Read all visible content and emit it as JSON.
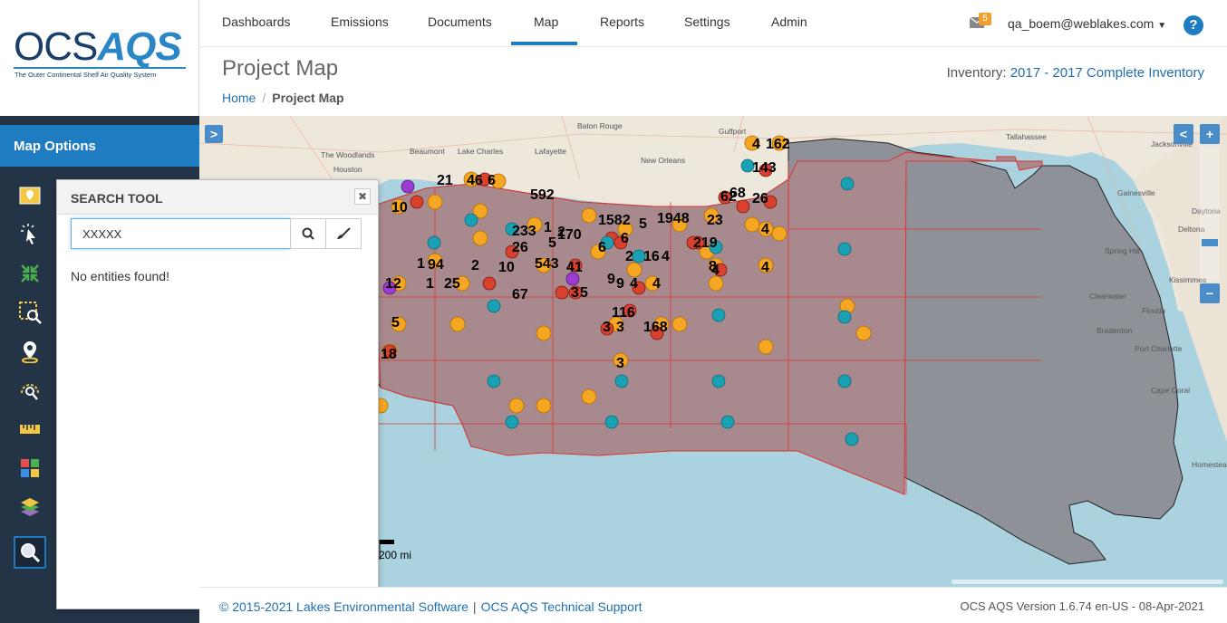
{
  "brand": {
    "logo_ocs": "OCS",
    "logo_aqs": "AQS",
    "tagline": "The Outer Continental Shelf Air Quality System"
  },
  "nav": {
    "items": [
      {
        "label": "Dashboards"
      },
      {
        "label": "Emissions"
      },
      {
        "label": "Documents"
      },
      {
        "label": "Map"
      },
      {
        "label": "Reports"
      },
      {
        "label": "Settings"
      },
      {
        "label": "Admin"
      }
    ],
    "active": "Map",
    "mail_count": "5",
    "user": "qa_boem@weblakes.com",
    "help": "?"
  },
  "page": {
    "title": "Project Map",
    "inventory_label": "Inventory:",
    "inventory_value": "2017 - 2017 Complete Inventory",
    "breadcrumb": {
      "home": "Home",
      "current": "Project Map"
    }
  },
  "sidebar": {
    "map_options": "Map Options",
    "tools": [
      "map-marker-icon",
      "pointer-select-icon",
      "collapse-icon",
      "area-search-icon",
      "location-pin-icon",
      "radius-search-icon",
      "ruler-icon",
      "legend-grid-icon",
      "layers-icon",
      "search-icon"
    ]
  },
  "map": {
    "scale_label": "200 mi",
    "controls": {
      "expand": ">",
      "collapse": "<",
      "zoom_in": "+",
      "zoom_out": "−"
    },
    "cities": [
      "Baton Rouge",
      "Gulfport",
      "Tallahassee",
      "Jacksonville",
      "Beaumont",
      "Lake Charles",
      "Lafayette",
      "New Orleans",
      "The Woodlands",
      "Houston",
      "Gainesville",
      "Daytona",
      "Deltona",
      "Spring Hill",
      "Kissimmee",
      "Clearwater",
      "Florida",
      "Bradenton",
      "Port Charlotte",
      "Cape Coral",
      "Homestead"
    ]
  },
  "search_tool": {
    "title": "SEARCH TOOL",
    "close": "✖",
    "value": "XXXXX",
    "no_results": "No entities found!"
  },
  "footer": {
    "left_1": "© 2015-2021 Lakes Environmental Software",
    "left_2": "OCS AQS Technical Support",
    "right": "OCS AQS Version 1.6.74 en-US - 08-Apr-2021"
  },
  "colors": {
    "primary": "#1f7cc1",
    "sidebar": "#243447",
    "water": "#aad3df",
    "lease_area": "#a88a8e",
    "deep_area": "#8e9298"
  }
}
